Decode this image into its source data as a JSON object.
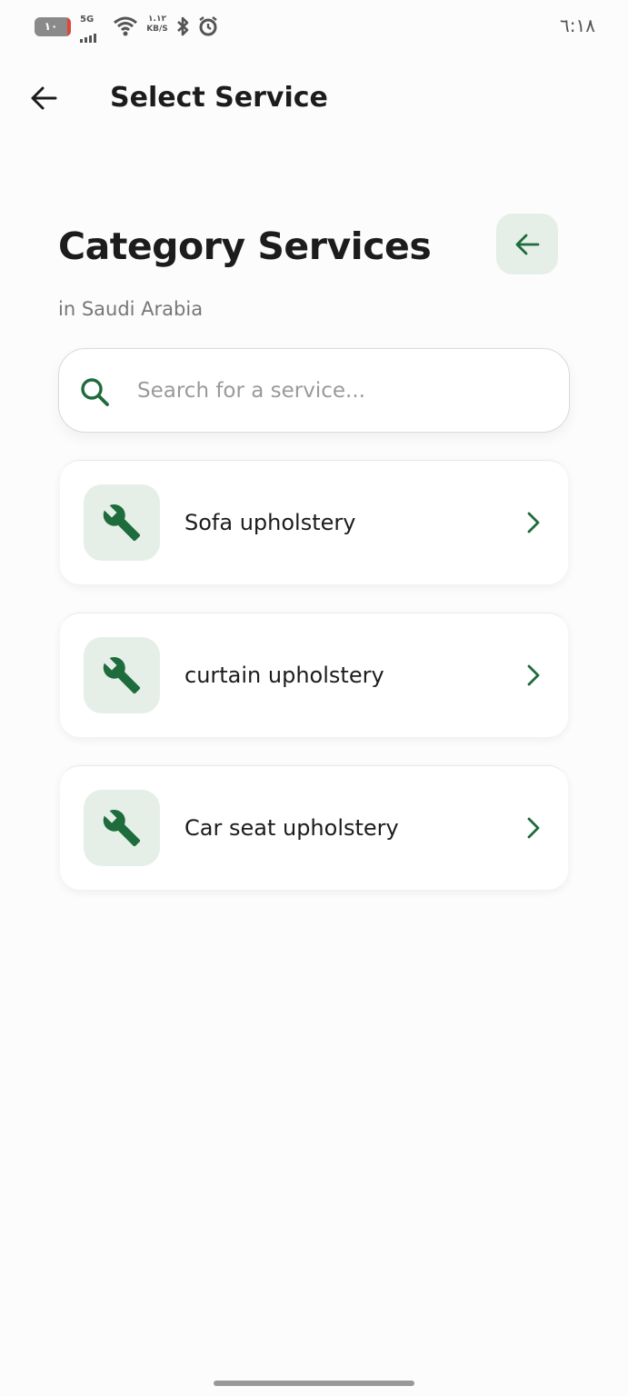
{
  "status_bar": {
    "battery_level": "١٠",
    "network": "5G",
    "speed_value": "١.١٢",
    "speed_unit": "KB/S",
    "time": "٦:١٨"
  },
  "app_bar": {
    "title": "Select Service",
    "back_icon": "arrow-left-icon"
  },
  "header": {
    "title": "Category Services",
    "subtitle": "in Saudi Arabia",
    "back_button_icon": "arrow-left-icon"
  },
  "search": {
    "value": "",
    "placeholder": "Search for a service..."
  },
  "services": [
    {
      "label": "Sofa upholstery",
      "icon": "wrench-icon"
    },
    {
      "label": "curtain upholstery",
      "icon": "wrench-icon"
    },
    {
      "label": "Car seat upholstery",
      "icon": "wrench-icon"
    }
  ],
  "colors": {
    "accent": "#1e6b3c",
    "accent_bg": "#e5efe8",
    "battery_low": "#e0473a"
  }
}
